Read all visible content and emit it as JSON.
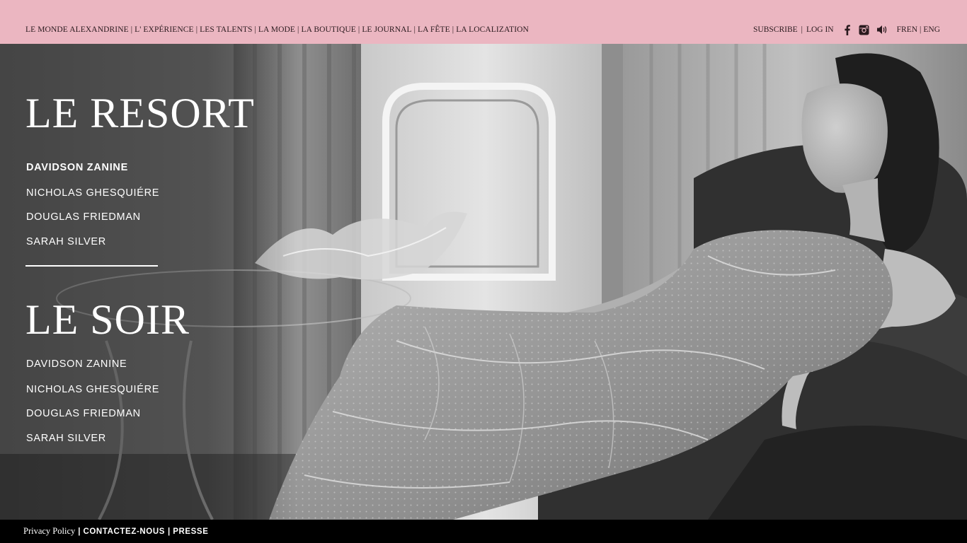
{
  "colors": {
    "topbar": "#ebb6c1",
    "text_dark": "#2a1a1e",
    "footer": "#000000",
    "menu_text": "#ffffff"
  },
  "header": {
    "nav": [
      "LE MONDE ALEXANDRINE",
      "L' EXPÉRIENCE",
      "LES TALENTS",
      "LA MODE",
      "LA BOUTIQUE",
      "LE JOURNAL",
      "LA FÊTE",
      "LA LOCALIZATION"
    ],
    "nav_separator": "|",
    "subscribe": "SUBSCRIBE",
    "login": "LOG IN",
    "icons": [
      "facebook-icon",
      "instagram-icon",
      "sound-icon"
    ],
    "lang_fr": "FR",
    "lang_en": "EN",
    "lang_enc": "ENG"
  },
  "resort": {
    "title": "LE RESORT",
    "items": [
      "DAVIDSON ZANINE",
      "NICHOLAS GHESQUIÉRE",
      "DOUGLAS FRIEDMAN",
      "SARAH SILVER"
    ],
    "active_index": 0
  },
  "soir": {
    "title": "LE SOIR",
    "items": [
      "DAVIDSON ZANINE",
      "NICHOLAS GHESQUIÉRE",
      "DOUGLAS FRIEDMAN",
      "SARAH SILVER"
    ]
  },
  "footer": {
    "privacy": "Privacy Policy",
    "contact": "CONTACTEZ-NOUS",
    "press": "PRESSE",
    "separator": "|"
  }
}
